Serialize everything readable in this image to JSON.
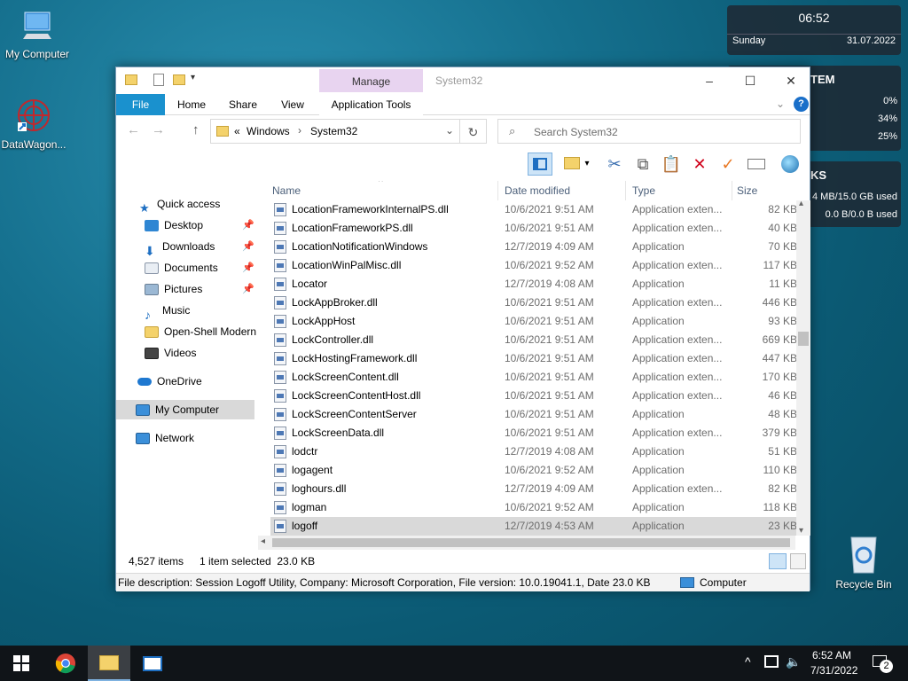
{
  "desktop": {
    "icons": [
      {
        "label": "My Computer"
      },
      {
        "label": "DataWagon..."
      },
      {
        "label": "Recycle Bin"
      }
    ]
  },
  "clock_widget": {
    "time": "06:52",
    "day": "Sunday",
    "date": "31.07.2022"
  },
  "system_widget": {
    "title": "TEM",
    "cpu": "0%",
    "ram": "34%",
    "swap": "25%"
  },
  "disks_widget": {
    "title": "KS",
    "disk1": "4 MB/15.0 GB used",
    "disk2": "0.0 B/0.0 B used"
  },
  "window": {
    "title": "System32",
    "manage_tab": "Manage",
    "tabs": {
      "file": "File",
      "home": "Home",
      "share": "Share",
      "view": "View",
      "app_tools": "Application Tools"
    },
    "address": {
      "prefix": "«",
      "crumb1": "Windows",
      "crumb2": "System32"
    },
    "search_placeholder": "Search System32",
    "nav": {
      "quick_access": "Quick access",
      "desktop": "Desktop",
      "downloads": "Downloads",
      "documents": "Documents",
      "pictures": "Pictures",
      "music": "Music",
      "open_shell": "Open-Shell Modern",
      "videos": "Videos",
      "onedrive": "OneDrive",
      "my_computer": "My Computer",
      "network": "Network"
    },
    "columns": {
      "name": "Name",
      "date": "Date modified",
      "type": "Type",
      "size": "Size"
    },
    "files": [
      {
        "name": "LocationFrameworkInternalPS.dll",
        "date": "10/6/2021 9:51 AM",
        "type": "Application exten...",
        "size": "82 KB"
      },
      {
        "name": "LocationFrameworkPS.dll",
        "date": "10/6/2021 9:51 AM",
        "type": "Application exten...",
        "size": "40 KB"
      },
      {
        "name": "LocationNotificationWindows",
        "date": "12/7/2019 4:09 AM",
        "type": "Application",
        "size": "70 KB"
      },
      {
        "name": "LocationWinPalMisc.dll",
        "date": "10/6/2021 9:52 AM",
        "type": "Application exten...",
        "size": "117 KB"
      },
      {
        "name": "Locator",
        "date": "12/7/2019 4:08 AM",
        "type": "Application",
        "size": "11 KB"
      },
      {
        "name": "LockAppBroker.dll",
        "date": "10/6/2021 9:51 AM",
        "type": "Application exten...",
        "size": "446 KB"
      },
      {
        "name": "LockAppHost",
        "date": "10/6/2021 9:51 AM",
        "type": "Application",
        "size": "93 KB"
      },
      {
        "name": "LockController.dll",
        "date": "10/6/2021 9:51 AM",
        "type": "Application exten...",
        "size": "669 KB"
      },
      {
        "name": "LockHostingFramework.dll",
        "date": "10/6/2021 9:51 AM",
        "type": "Application exten...",
        "size": "447 KB"
      },
      {
        "name": "LockScreenContent.dll",
        "date": "10/6/2021 9:51 AM",
        "type": "Application exten...",
        "size": "170 KB"
      },
      {
        "name": "LockScreenContentHost.dll",
        "date": "10/6/2021 9:51 AM",
        "type": "Application exten...",
        "size": "46 KB"
      },
      {
        "name": "LockScreenContentServer",
        "date": "10/6/2021 9:51 AM",
        "type": "Application",
        "size": "48 KB"
      },
      {
        "name": "LockScreenData.dll",
        "date": "10/6/2021 9:51 AM",
        "type": "Application exten...",
        "size": "379 KB"
      },
      {
        "name": "lodctr",
        "date": "12/7/2019 4:08 AM",
        "type": "Application",
        "size": "51 KB"
      },
      {
        "name": "logagent",
        "date": "10/6/2021 9:52 AM",
        "type": "Application",
        "size": "110 KB"
      },
      {
        "name": "loghours.dll",
        "date": "12/7/2019 4:09 AM",
        "type": "Application exten...",
        "size": "82 KB"
      },
      {
        "name": "logman",
        "date": "10/6/2021 9:52 AM",
        "type": "Application",
        "size": "118 KB"
      },
      {
        "name": "logoff",
        "date": "12/7/2019 4:53 AM",
        "type": "Application",
        "size": "23 KB"
      }
    ],
    "status": {
      "count": "4,527 items",
      "selected": "1 item selected  23.0 KB"
    },
    "details": {
      "description": "File description: Session Logoff Utility, Company: Microsoft Corporation, File version: 10.0.19041.1, Date 23.0 KB",
      "location": "Computer"
    }
  },
  "taskbar": {
    "time": "6:52 AM",
    "date": "7/31/2022",
    "notifications": "2"
  }
}
